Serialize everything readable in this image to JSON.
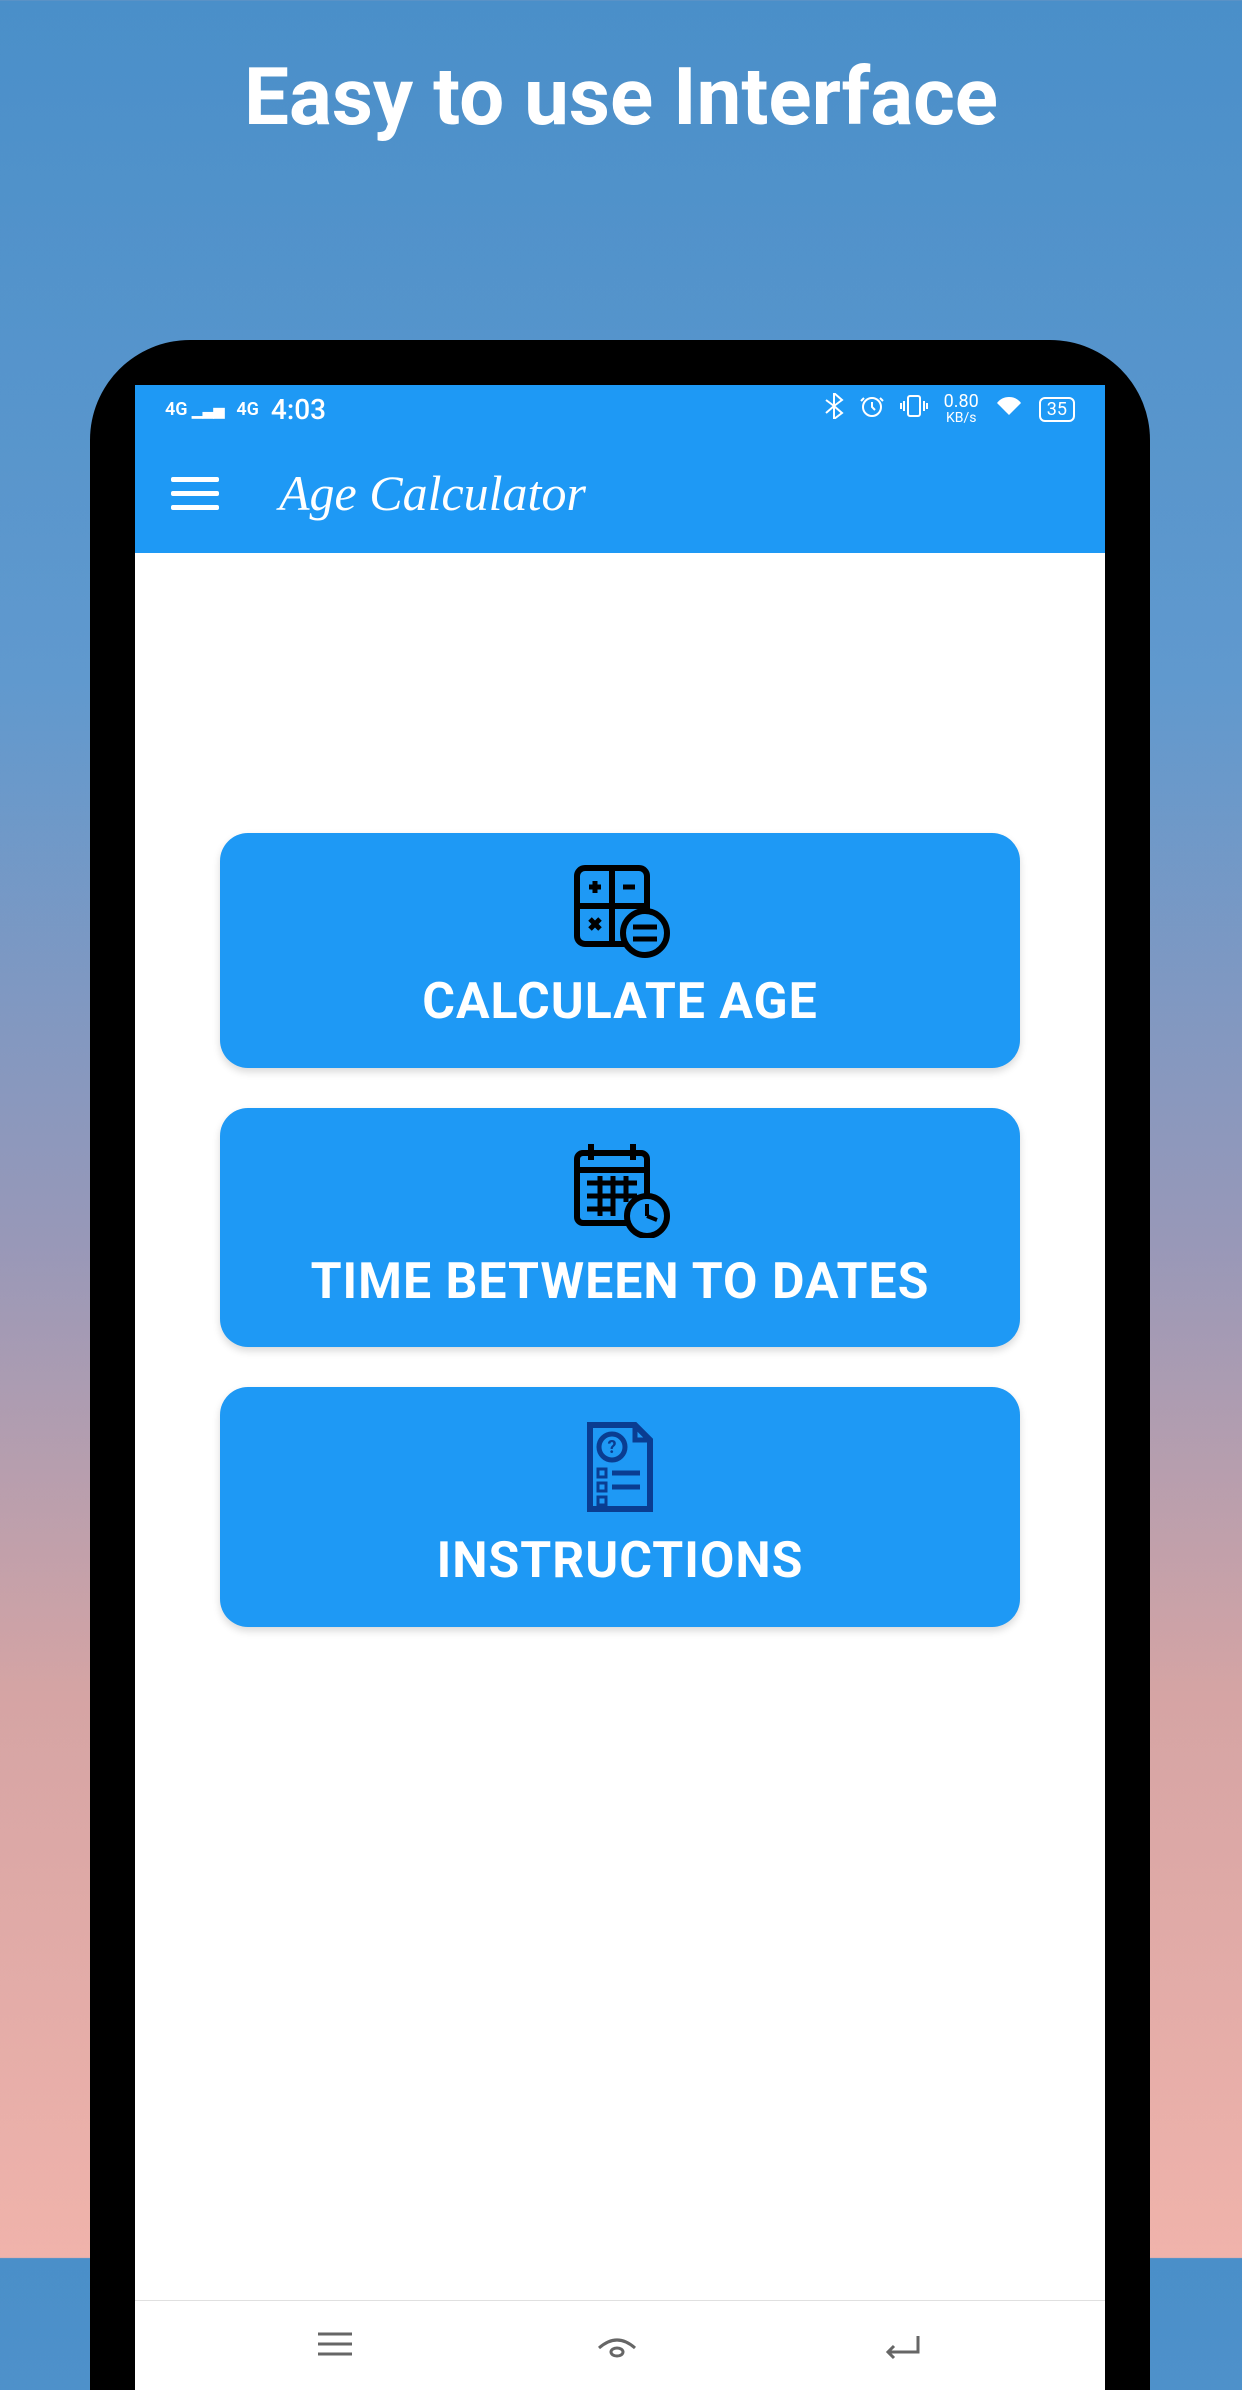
{
  "promo": {
    "title": "Easy to use Interface"
  },
  "statusBar": {
    "signal": "4G",
    "time": "4:03",
    "dataRate": "0.80",
    "dataUnit": "KB/s",
    "battery": "35"
  },
  "appBar": {
    "title": "Age Calculator"
  },
  "menu": {
    "calculateAge": "CALCULATE AGE",
    "timeBetween": "TIME BETWEEN TO DATES",
    "instructions": "INSTRUCTIONS"
  }
}
